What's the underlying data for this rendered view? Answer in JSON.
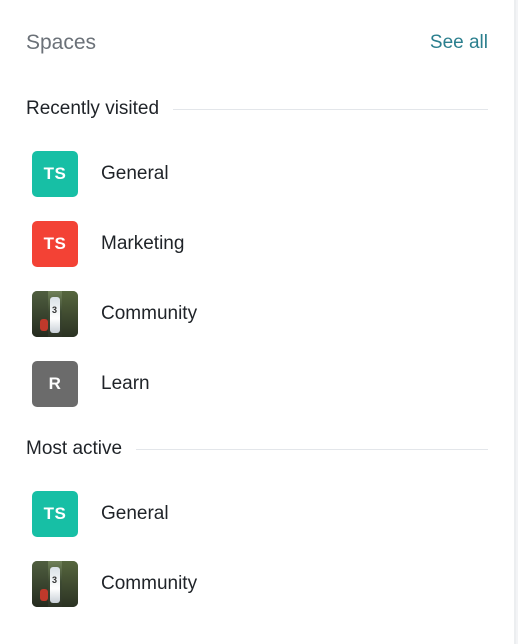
{
  "header": {
    "title": "Spaces",
    "see_all": "See all"
  },
  "colors": {
    "teal": "#14b8a6",
    "red": "#f04438",
    "gray": "#6b6b6b",
    "link": "#2b7f8e"
  },
  "recently_visited": {
    "title": "Recently visited",
    "items": [
      {
        "label": "General",
        "avatar_text": "TS",
        "avatar_type": "initials",
        "avatar_color": "#17bfa5"
      },
      {
        "label": "Marketing",
        "avatar_text": "TS",
        "avatar_type": "initials",
        "avatar_color": "#f34235"
      },
      {
        "label": "Community",
        "avatar_text": "3",
        "avatar_type": "image",
        "avatar_color": ""
      },
      {
        "label": "Learn",
        "avatar_text": "R",
        "avatar_type": "initials",
        "avatar_color": "#6b6b6b"
      }
    ]
  },
  "most_active": {
    "title": "Most active",
    "items": [
      {
        "label": "General",
        "avatar_text": "TS",
        "avatar_type": "initials",
        "avatar_color": "#17bfa5"
      },
      {
        "label": "Community",
        "avatar_text": "3",
        "avatar_type": "image",
        "avatar_color": ""
      }
    ]
  }
}
